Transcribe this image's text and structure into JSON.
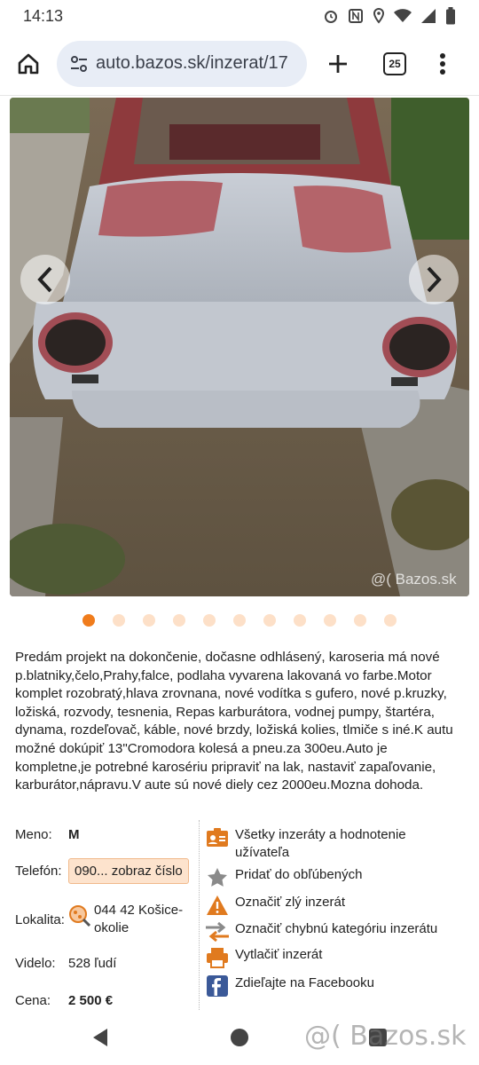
{
  "status_bar": {
    "time": "14:13",
    "icons": [
      "alarm-icon",
      "nfc-icon",
      "location-icon",
      "wifi-icon",
      "signal-icon",
      "battery-icon"
    ]
  },
  "browser": {
    "url": "auto.bazos.sk/inzerat/17",
    "tab_count": "25"
  },
  "gallery": {
    "watermark": "@( Bazos.sk",
    "dot_count": 11,
    "active_dot": 0
  },
  "description": "Predám projekt na dokončenie, dočasne odhlásený, karoseria má nové p.blatniky,čelo,Prahy,falce, podlaha vyvarena lakovaná vo farbe.Motor komplet rozobratý,hlava zrovnana, nové vodítka s gufero, nové p.kruzky, ložiská, rozvody, tesnenia, Repas karburátora, vodnej pumpy, štartéra, dynama, rozdeľovač, káble, nové brzdy, ložiská kolies, tlmiče s iné.K autu možné dokúpiť 13\"Cromodora kolesá a pneu.za 300eu.Auto je kompletne,je potrebné karosériu pripraviť na lak, nastaviť zapaľovanie, karburátor,nápravu.V aute sú nové diely cez 2000eu.Mozna dohoda.",
  "details": {
    "name_label": "Meno:",
    "name_value": "M",
    "phone_label": "Telefón:",
    "phone_button": "090... zobraz číslo",
    "location_label": "Lokalita:",
    "location_value": "044 42 Košice-okolie",
    "views_label": "Videlo:",
    "views_value": "528 ľudí",
    "price_label": "Cena:",
    "price_value": "2 500 €"
  },
  "actions": [
    {
      "label": "Všetky inzeráty a hodnotenie užívateľa",
      "icon": "user-card-icon"
    },
    {
      "label": "Pridať do obľúbených",
      "icon": "star-icon"
    },
    {
      "label": "Označiť zlý inzerát",
      "icon": "warning-icon"
    },
    {
      "label": "Označiť chybnú kategóriu inzerátu",
      "icon": "swap-arrows-icon"
    },
    {
      "label": "Vytlačiť inzerát",
      "icon": "printer-icon"
    },
    {
      "label": "Zdieľajte na Facebooku",
      "icon": "facebook-icon"
    }
  ],
  "nav_watermark": "@( Bazos.sk",
  "colors": {
    "accent": "#f07c1c",
    "dot_inactive": "#fde0c8",
    "phone_button_bg": "#fde3cd",
    "url_pill": "#e8edf6"
  }
}
